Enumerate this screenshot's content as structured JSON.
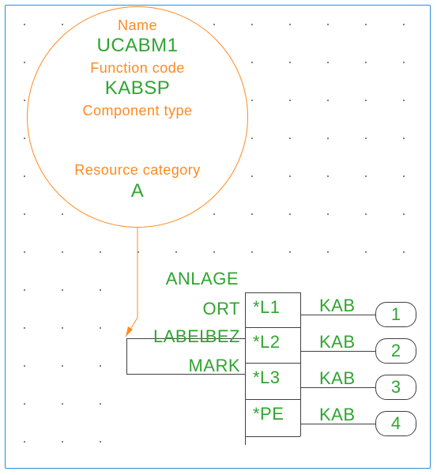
{
  "info": {
    "name_label": "Name",
    "name_value": "UCABM1",
    "func_label": "Function code",
    "func_value": "KABSP",
    "comp_label": "Component type",
    "comp_value": "",
    "res_label": "Resource category",
    "res_value": "A"
  },
  "component": {
    "anlage": "ANLAGE",
    "ort": "ORT",
    "label": "LABEL",
    "bez": "BEZ",
    "mark": "MARK"
  },
  "pins": [
    {
      "star": "*L1",
      "name": "KAB",
      "num": "1"
    },
    {
      "star": "*L2",
      "name": "KAB",
      "num": "2"
    },
    {
      "star": "*L3",
      "name": "KAB",
      "num": "3"
    },
    {
      "star": "*PE",
      "name": "KAB",
      "num": "4"
    }
  ]
}
